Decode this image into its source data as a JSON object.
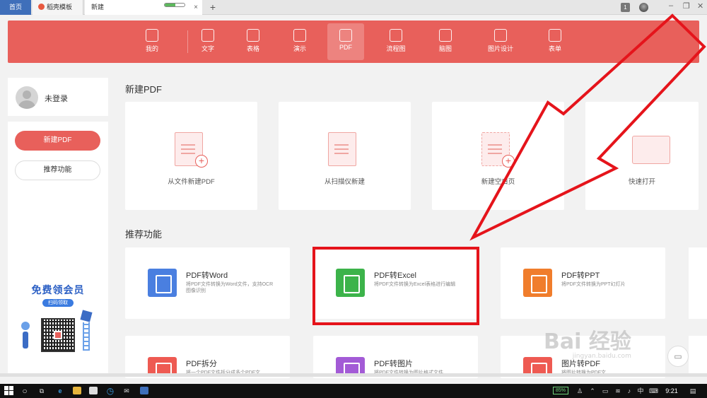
{
  "titlebar": {
    "tabs": [
      {
        "label": "首页"
      },
      {
        "label": "稻壳模板"
      },
      {
        "label": "新建"
      }
    ],
    "progress_fraction": 0.55,
    "close_glyph": "×",
    "new_tab_glyph": "+",
    "message_badge": "1",
    "window_buttons": [
      "–",
      "❐",
      "✕"
    ]
  },
  "nav": {
    "items": [
      {
        "label": "我的",
        "icon": "star-icon"
      },
      {
        "label": "文字",
        "icon": "document-icon"
      },
      {
        "label": "表格",
        "icon": "table-icon"
      },
      {
        "label": "演示",
        "icon": "presentation-icon"
      },
      {
        "label": "PDF",
        "icon": "pdf-icon",
        "active": true
      },
      {
        "label": "流程图",
        "icon": "flowchart-icon"
      },
      {
        "label": "脑图",
        "icon": "mindmap-icon"
      },
      {
        "label": "图片设计",
        "icon": "image-design-icon"
      },
      {
        "label": "表单",
        "icon": "form-icon"
      }
    ],
    "accent": "#e8605b"
  },
  "sidebar": {
    "user_name": "未登录",
    "new_pdf_button": "新建PDF",
    "recommend_button": "推荐功能",
    "promo_title": "免费领会员",
    "promo_badge": "扫码领取"
  },
  "main": {
    "new_section_title": "新建PDF",
    "new_cards": [
      {
        "label": "从文件新建PDF",
        "icon": "file-plus-icon"
      },
      {
        "label": "从扫描仪新建",
        "icon": "scanner-icon"
      },
      {
        "label": "新建空白页",
        "icon": "blank-page-plus-icon"
      },
      {
        "label": "快速打开",
        "icon": "folder-pdf-icon"
      }
    ],
    "rec_section_title": "推荐功能",
    "rec_cards": [
      {
        "name": "PDF转Word",
        "desc": "将PDF文件转换为Word文件，支持OCR图像识别",
        "color": "#4a7fe0",
        "icon": "pdf-to-word-icon"
      },
      {
        "name": "PDF转Excel",
        "desc": "将PDF文件转换为Excel表格进行编辑",
        "color": "#3cb34a",
        "icon": "pdf-to-excel-icon"
      },
      {
        "name": "PDF转PPT",
        "desc": "将PDF文件转换为PPT幻灯片",
        "color": "#f07d2c",
        "icon": "pdf-to-ppt-icon"
      },
      {
        "name": "PDF拆分",
        "desc": "将一个PDF文件拆分成多个PDF文",
        "color": "#ee5a52",
        "icon": "pdf-split-icon"
      },
      {
        "name": "PDF转图片",
        "desc": "将PDF文件转换为图片格式文件,",
        "color": "#a35bd6",
        "icon": "pdf-to-image-icon"
      },
      {
        "name": "图片转PDF",
        "desc": "将图片转换为PDF文",
        "color": "#ee5a52",
        "icon": "image-to-pdf-icon"
      }
    ]
  },
  "watermark": {
    "text": "Bai 经验",
    "sub": "jingyan.baidu.com"
  },
  "taskbar": {
    "battery": "85%",
    "ime": "中",
    "time": "9:21"
  }
}
